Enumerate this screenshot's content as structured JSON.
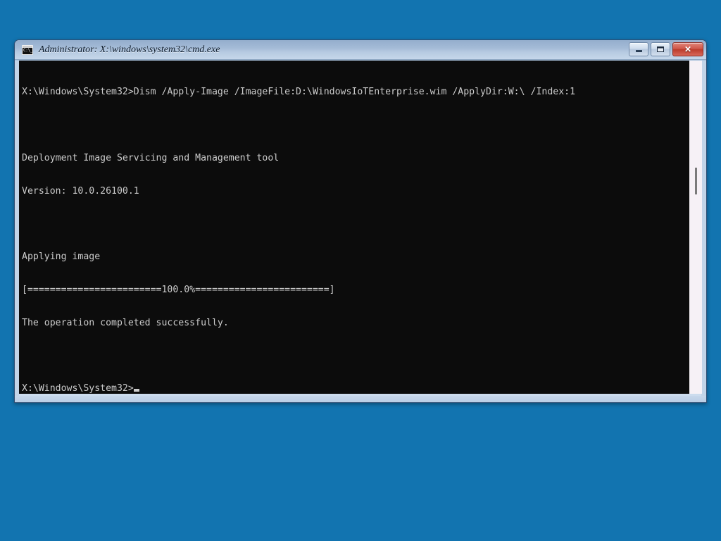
{
  "desktop": {
    "background_color": "#1274b0"
  },
  "window": {
    "title": "Administrator: X:\\windows\\system32\\cmd.exe",
    "icon": "cmd-console-icon",
    "icon_text": "C:\\_",
    "frame_color": "#c2d4e8",
    "titlebar_color": "#a3bad6",
    "controls": {
      "minimize_label": "",
      "minimize_tooltip": "Minimize",
      "maximize_label": "",
      "maximize_tooltip": "Maximize",
      "close_label": "✕",
      "close_tooltip": "Close"
    }
  },
  "console": {
    "background_color": "#0c0c0c",
    "foreground_color": "#cccccc",
    "prompt": "X:\\Windows\\System32>",
    "command": "Dism /Apply-Image /ImageFile:D:\\WindowsIoTEnterprise.wim /ApplyDir:W:\\ /Index:1",
    "lines": [
      "X:\\Windows\\System32>Dism /Apply-Image /ImageFile:D:\\WindowsIoTEnterprise.wim /ApplyDir:W:\\ /Index:1",
      "",
      "Deployment Image Servicing and Management tool",
      "Version: 10.0.26100.1",
      "",
      "Applying image",
      "[========================100.0%========================]",
      "The operation completed successfully.",
      "",
      "X:\\Windows\\System32>"
    ],
    "tool_banner": "Deployment Image Servicing and Management tool",
    "version": "Version: 10.0.26100.1",
    "operation_label": "Applying image",
    "progress": {
      "percent": "100.0%",
      "percent_value": 100,
      "bar_open": "[",
      "bar_close": "]",
      "fill_char": "=",
      "left_fill_count": 24,
      "right_fill_count": 24,
      "rendered": "[========================100.0%========================]"
    },
    "result_message": "The operation completed successfully.",
    "cursor": "block-cursor"
  },
  "scrollbar": {
    "track_color": "#f6f1f6",
    "thumb_color": "#7b7b7b",
    "orientation": "vertical"
  }
}
